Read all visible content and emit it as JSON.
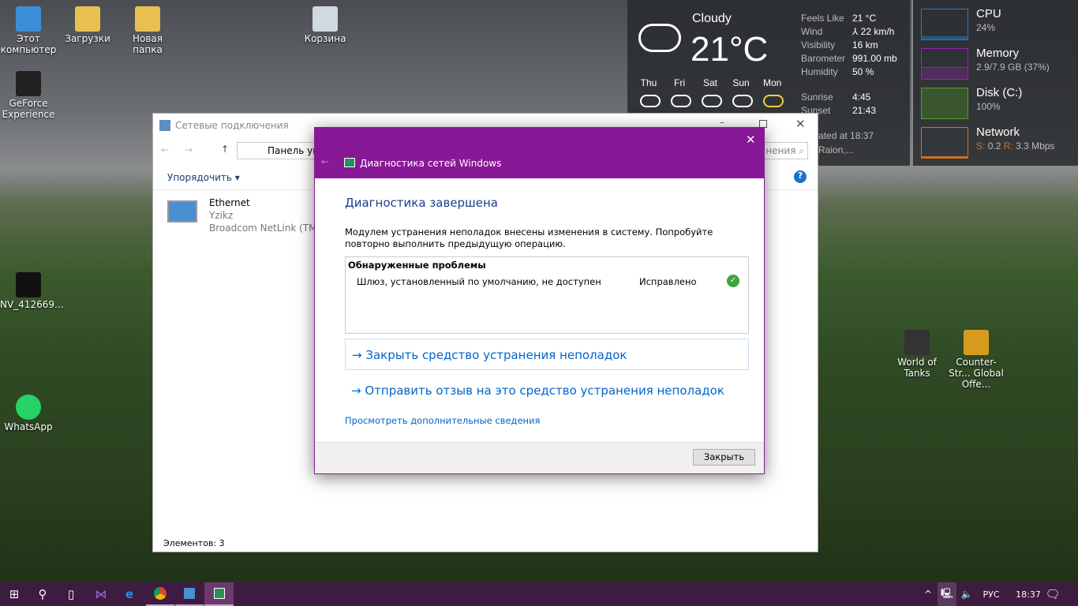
{
  "desktop": {
    "icons": [
      {
        "label": "Этот компьютер",
        "icon": "computer-icon"
      },
      {
        "label": "Загрузки",
        "icon": "downloads-folder-icon"
      },
      {
        "label": "Новая папка",
        "icon": "folder-icon"
      },
      {
        "label": "Корзина",
        "icon": "recycle-bin-icon"
      },
      {
        "label": "GeForce Experience",
        "icon": "geforce-icon"
      },
      {
        "label": "NV_412669...",
        "icon": "file-icon"
      },
      {
        "label": "WhatsApp",
        "icon": "whatsapp-icon"
      },
      {
        "label": "World of Tanks",
        "icon": "wot-icon"
      },
      {
        "label": "Counter-Str... Global Offe...",
        "icon": "csgo-icon"
      }
    ]
  },
  "weather": {
    "condition": "Cloudy",
    "temp": "21°C",
    "details": [
      {
        "label": "Feels Like",
        "value": "21 °C"
      },
      {
        "label": "Wind",
        "value": "⅄ 22 km/h"
      },
      {
        "label": "Visibility",
        "value": "16 km"
      },
      {
        "label": "Barometer",
        "value": "991.00 mb"
      },
      {
        "label": "Humidity",
        "value": "50 %"
      }
    ],
    "sunrise_label": "Sunrise",
    "sunrise": "4:45",
    "sunset_label": "Sunset",
    "sunset": "21:43",
    "updated": "Updated at 18:37",
    "location": "Ufa Raion,...",
    "forecast": [
      {
        "day": "Thu",
        "icon": "rain-icon"
      },
      {
        "day": "Fri",
        "icon": "thunderstorm-icon"
      },
      {
        "day": "Sat",
        "icon": "rain-icon"
      },
      {
        "day": "Sun",
        "icon": "rain-icon"
      },
      {
        "day": "Mon",
        "icon": "partly-sunny-icon"
      }
    ]
  },
  "monitor": {
    "cpu": {
      "label": "CPU",
      "value": "24%",
      "color": "#1e7fd0"
    },
    "memory": {
      "label": "Memory",
      "value": "2.9/7.9 GB (37%)",
      "color": "#9b1fb4"
    },
    "disk": {
      "label": "Disk (C:)",
      "value": "100%",
      "color": "#4fa51e"
    },
    "network": {
      "label": "Network",
      "s_label": "S:",
      "s": "0.2",
      "r_label": "R:",
      "r": "3.3 Mbps",
      "color": "#d0701e"
    }
  },
  "explorer": {
    "title": "Сетевые подключения",
    "address": "Панель упр",
    "search_placeholder": "нения",
    "organize": "Упорядочить ▾",
    "item": {
      "name": "Ethernet",
      "network": "Yzikz",
      "adapter": "Broadcom NetLink (TM) G"
    },
    "status": "Элементов: 3"
  },
  "dialog": {
    "title": "Диагностика сетей Windows",
    "heading": "Диагностика завершена",
    "message": "Модулем устранения неполадок внесены изменения в систему. Попробуйте повторно выполнить предыдущую операцию.",
    "problems_header": "Обнаруженные проблемы",
    "problem": "Шлюз, установленный по умолчанию, не доступен",
    "problem_status": "Исправлено",
    "action1": "Закрыть средство устранения неполадок",
    "action2": "Отправить отзыв на это средство устранения неполадок",
    "details_link": "Просмотреть дополнительные сведения",
    "close_button": "Закрыть"
  },
  "taskbar": {
    "lang": "РУС",
    "time": "18:37",
    "accent": "#3e1b40"
  }
}
